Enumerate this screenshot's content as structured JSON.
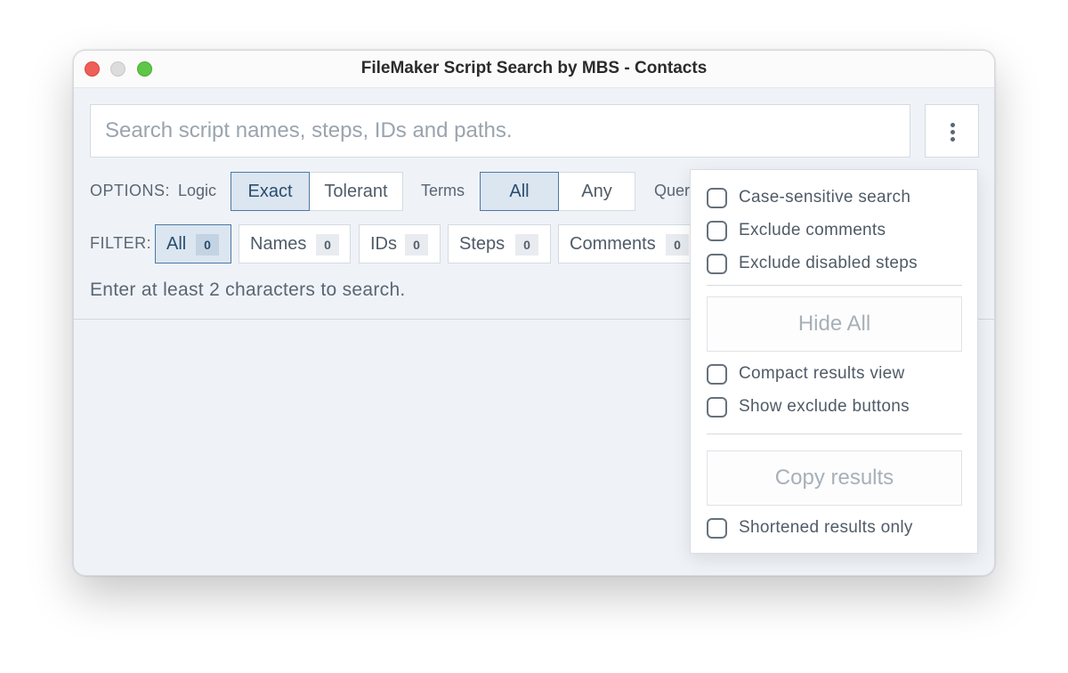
{
  "window": {
    "title": "FileMaker Script Search by MBS - Contacts"
  },
  "search": {
    "placeholder": "Search script names, steps, IDs and paths.",
    "value": ""
  },
  "options": {
    "label": "OPTIONS:",
    "logic_label": "Logic",
    "logic": [
      "Exact",
      "Tolerant"
    ],
    "logic_selected": "Exact",
    "terms_label": "Terms",
    "terms": [
      "All",
      "Any"
    ],
    "terms_selected": "All",
    "query_label_partial": "Quer"
  },
  "filter": {
    "label": "FILTER:",
    "items": [
      {
        "label": "All",
        "count": "0"
      },
      {
        "label": "Names",
        "count": "0"
      },
      {
        "label": "IDs",
        "count": "0"
      },
      {
        "label": "Steps",
        "count": "0"
      },
      {
        "label": "Comments",
        "count": "0"
      }
    ],
    "selected": "All"
  },
  "status": {
    "hint": "Enter at least 2 characters to search."
  },
  "menu": {
    "checkboxes_top": [
      {
        "label": "Case-sensitive search",
        "checked": false
      },
      {
        "label": "Exclude comments",
        "checked": false
      },
      {
        "label": "Exclude disabled steps",
        "checked": false
      }
    ],
    "hide_all_label": "Hide All",
    "checkboxes_mid": [
      {
        "label": "Compact results view",
        "checked": false
      },
      {
        "label": "Show exclude buttons",
        "checked": false
      }
    ],
    "copy_results_label": "Copy results",
    "checkboxes_bottom": [
      {
        "label": "Shortened results only",
        "checked": false
      }
    ]
  }
}
